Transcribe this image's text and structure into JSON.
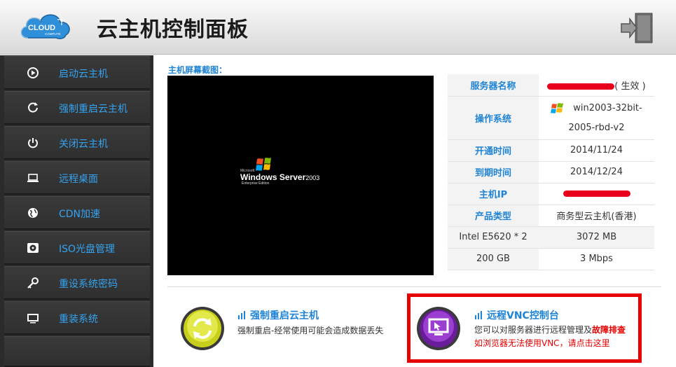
{
  "header": {
    "logo_text": "CLOUD",
    "logo_sub": "COMPUTE",
    "title": "云主机控制面板",
    "exit_icon": "exit-door-icon"
  },
  "sidebar": {
    "items": [
      {
        "label": "启动云主机",
        "icon": "play-icon"
      },
      {
        "label": "强制重启云主机",
        "icon": "restart-icon"
      },
      {
        "label": "关闭云主机",
        "icon": "power-icon"
      },
      {
        "label": "远程桌面",
        "icon": "laptop-icon"
      },
      {
        "label": "CDN加速",
        "icon": "globe-icon"
      },
      {
        "label": "ISO光盘管理",
        "icon": "disc-icon"
      },
      {
        "label": "重设系统密码",
        "icon": "key-icon"
      },
      {
        "label": "重装系统",
        "icon": "monitor-icon"
      }
    ]
  },
  "screenshot": {
    "label": "主机屏幕截图：",
    "brand_small": "Microsoft",
    "brand_main": "Windows Server",
    "brand_version": "2003",
    "edition": "Enterprise Edition"
  },
  "info": {
    "server_name_label": "服务器名称",
    "server_name_status": "( 生效 )",
    "os_label": "操作系统",
    "os_value_1": "win2003-32bit-",
    "os_value_2": "2005-rbd-v2",
    "open_time_label": "开通时间",
    "open_time": "2014/11/24",
    "expire_label": "到期时间",
    "expire_time": "2014/12/24",
    "ip_label": "主机IP",
    "product_label": "产品类型",
    "product_value": "商务型云主机(香港)",
    "cpu": "Intel E5620 * 2",
    "ram": "3072 MB",
    "disk": "200 GB",
    "bandwidth": "3 Mbps"
  },
  "actions": {
    "restart": {
      "title": "强制重启云主机",
      "desc": "强制重启-经常使用可能会造成数据丢失"
    },
    "vnc": {
      "title": "远程VNC控制台",
      "desc_1": "您可以对服务器进行远程管理及",
      "desc_1_emph": "故障排查",
      "desc_2": "如浏览器无法使用VNC，请点击这里"
    }
  },
  "colors": {
    "accent": "#1f84d6",
    "sidebar_text": "#34a3f0",
    "sidebar_bg": "#2b2b2b",
    "highlight": "#e60000"
  }
}
